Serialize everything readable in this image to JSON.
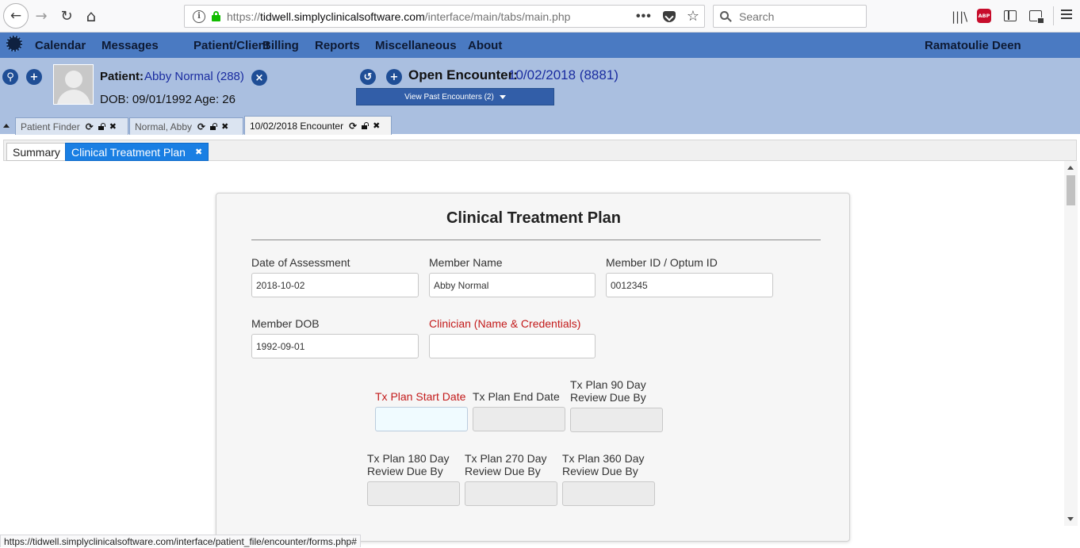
{
  "browser": {
    "url_prefix": "https://",
    "url_host": "tidwell.simplyclinicalsoftware.com",
    "url_path": "/interface/main/tabs/main.php",
    "search_placeholder": "Search",
    "more_label": "•••",
    "abp_label": "ABP",
    "back_glyph": "←",
    "forward_glyph": "→",
    "reload_glyph": "↻",
    "home_glyph": "⌂",
    "star_glyph": "☆",
    "library_glyph": "|||\\",
    "info_glyph": "i"
  },
  "menubar": {
    "items": [
      "Calendar",
      "Messages",
      "Patient/Client",
      "Billing",
      "Reports",
      "Miscellaneous",
      "About"
    ],
    "user": "Ramatoulie Deen"
  },
  "patient": {
    "label": "Patient:",
    "name": "Abby Normal (288)",
    "dob_line": "DOB: 09/01/1992 Age: 26",
    "search_glyph": "⚲",
    "plus_glyph": "+",
    "close_glyph": "×"
  },
  "encounter": {
    "label": "Open Encounter:",
    "value": "10/02/2018 (8881)",
    "past_button": "View Past Encounters  (2)",
    "history_glyph": "↺",
    "plus_glyph": "+"
  },
  "top_tabs": [
    {
      "label": "Patient Finder"
    },
    {
      "label": "Normal, Abby"
    },
    {
      "label": "10/02/2018 Encounter"
    }
  ],
  "tab_glyphs": {
    "refresh": "⟳",
    "close": "✖"
  },
  "sub_tabs": {
    "summary": "Summary",
    "active": "Clinical Treatment Plan",
    "close_glyph": "✖"
  },
  "form": {
    "title": "Clinical Treatment Plan",
    "date_of_assessment": {
      "label": "Date of Assessment",
      "value": "2018-10-02"
    },
    "member_name": {
      "label": "Member Name",
      "value": "Abby Normal"
    },
    "member_id": {
      "label": "Member ID / Optum ID",
      "value": "0012345"
    },
    "member_dob": {
      "label": "Member DOB",
      "value": "1992-09-01"
    },
    "clinician": {
      "label": "Clinician (Name & Credentials)",
      "value": ""
    },
    "tx_start": {
      "label": "Tx Plan Start Date",
      "value": ""
    },
    "tx_end": {
      "label": "Tx Plan End Date",
      "value": ""
    },
    "tx_90": {
      "label": "Tx Plan 90 Day Review Due By",
      "value": ""
    },
    "tx_180": {
      "label": "Tx Plan 180 Day Review Due By",
      "value": ""
    },
    "tx_270": {
      "label": "Tx Plan 270 Day Review Due By",
      "value": ""
    },
    "tx_360": {
      "label": "Tx Plan 360 Day Review Due By",
      "value": ""
    }
  },
  "status_bar": "https://tidwell.simplyclinicalsoftware.com/interface/patient_file/encounter/forms.php#",
  "colors": {
    "menubar": "#4a7ac2",
    "patient_header": "#aabfe0",
    "active_subtab": "#1a7fe3",
    "required_label": "#c31a1a",
    "link_blue": "#1a2ca0"
  }
}
